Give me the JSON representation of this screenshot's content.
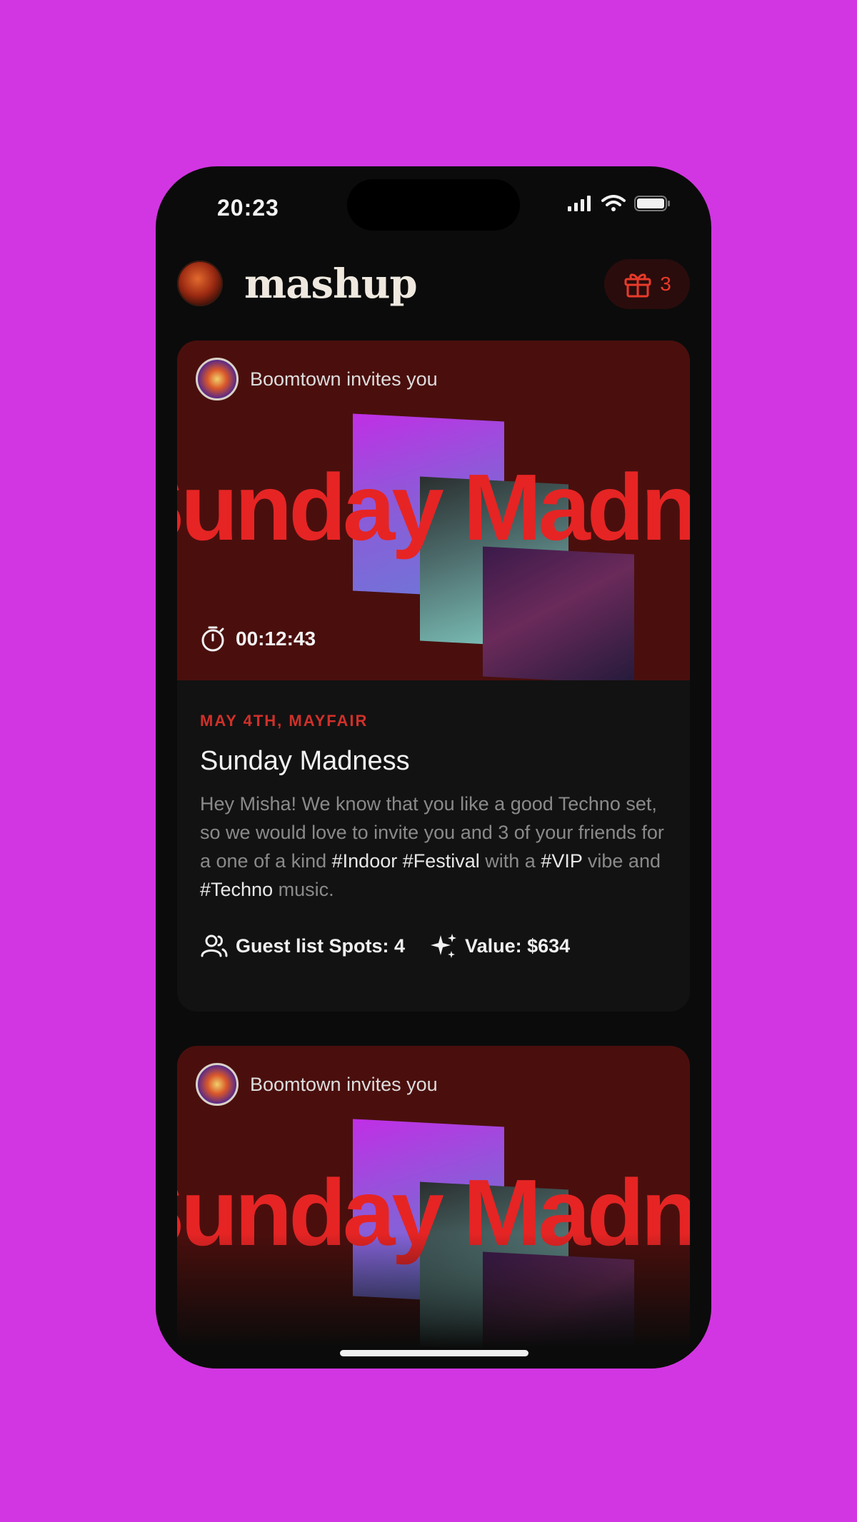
{
  "status_bar": {
    "time": "20:23"
  },
  "header": {
    "brand": "mashup",
    "gift_count": "3"
  },
  "cards": [
    {
      "host": "Boomtown invites you",
      "hero_title": "Sunday Madness",
      "timer": "00:12:43",
      "date": "MAY 4TH, MAYFAIR",
      "title": "Sunday Madness",
      "description": {
        "t1": "Hey Misha! We know that you like a good Techno set, so we would love to invite you and 3 of your friends for a one of a kind ",
        "tag1": "#Indoor",
        "t2": " ",
        "tag2": "#Festival",
        "t3": " with a ",
        "tag3": "#VIP",
        "t4": " vibe and ",
        "tag4": "#Techno",
        "t5": " music."
      },
      "guest_list": "Guest list Spots: 4",
      "value": "Value: $634"
    },
    {
      "host": "Boomtown invites you",
      "hero_title": "Sunday Madness"
    }
  ],
  "colors": {
    "background": "#d236e2",
    "accent": "#e62424",
    "hero_bg": "#4a0f0d"
  },
  "icons": [
    "signal-icon",
    "wifi-icon",
    "battery-icon",
    "gift-icon",
    "stopwatch-icon",
    "users-icon",
    "sparkle-icon"
  ]
}
